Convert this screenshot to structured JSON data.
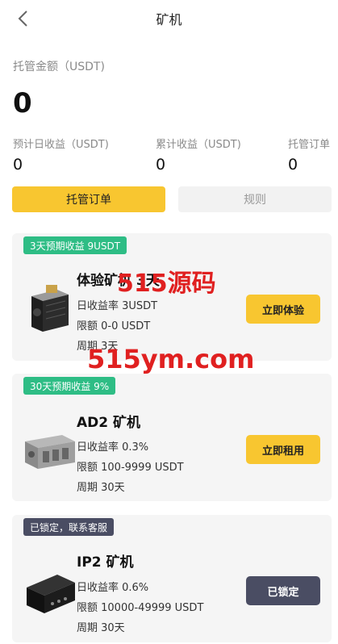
{
  "header": {
    "title": "矿机"
  },
  "summary": {
    "label": "托管金额（USDT)",
    "total": "0",
    "stats": [
      {
        "label": "预计日收益（USDT)",
        "value": "0"
      },
      {
        "label": "累计收益（USDT)",
        "value": "0"
      },
      {
        "label": "托管订单",
        "value": "0"
      }
    ]
  },
  "tabs": [
    {
      "label": "托管订单",
      "active": true
    },
    {
      "label": "规则",
      "active": false
    }
  ],
  "cards": [
    {
      "badge": "3天预期收益 9USDT",
      "name": "体验矿机 3天",
      "rate": "日收益率 3USDT",
      "limit": "限额 0-0 USDT",
      "period": "周期 3天",
      "button": "立即体验",
      "icon": "antminer-icon"
    },
    {
      "badge": "30天预期收益 9%",
      "name": "AD2 矿机",
      "rate": "日收益率 0.3%",
      "limit": "限额 100-9999 USDT",
      "period": "周期 30天",
      "button": "立即租用",
      "icon": "ad2-miner-icon"
    },
    {
      "badge": "已锁定，联系客服",
      "name": "IP2 矿机",
      "rate": "日收益率 0.6%",
      "limit": "限额 10000-49999 USDT",
      "period": "周期 30天",
      "button": "已锁定",
      "icon": "ip2-miner-icon"
    }
  ],
  "watermark": {
    "line1": "515源码",
    "line2": "515ym.com"
  },
  "colors": {
    "accent": "#f8c630",
    "green": "#2ebd85",
    "dark": "#4a4d63",
    "watermark": "#e02020"
  }
}
